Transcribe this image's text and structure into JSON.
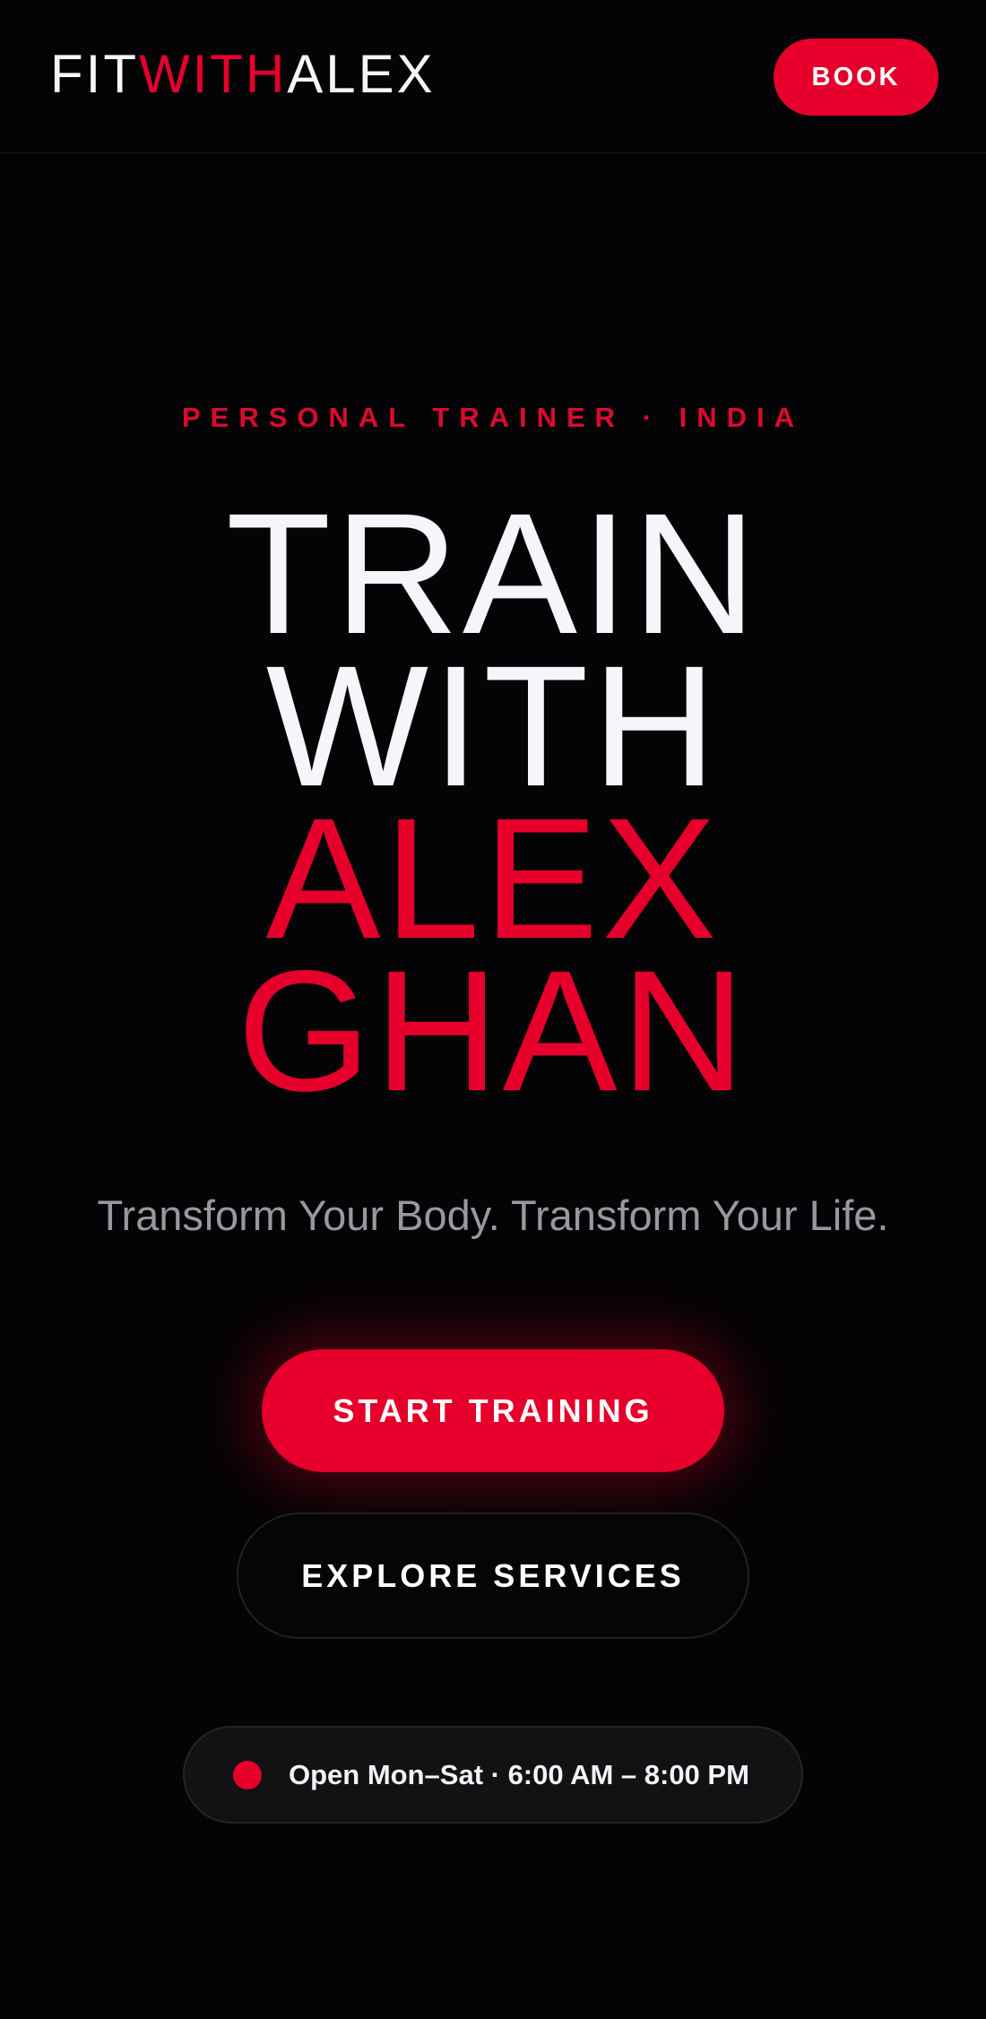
{
  "header": {
    "logo": {
      "part1": "FIT",
      "part2": "WITH",
      "part3": "ALEX"
    },
    "book_label": "BOOK"
  },
  "hero": {
    "eyebrow": "PERSONAL TRAINER · INDIA",
    "title_lines": [
      "TRAIN",
      "WITH",
      "ALEX",
      "GHAN"
    ],
    "tagline": "Transform Your Body. Transform Your Life.",
    "primary_cta": "START TRAINING",
    "secondary_cta": "EXPLORE SERVICES"
  },
  "hours": {
    "text": "Open Mon–Sat · 6:00 AM – 8:00 PM",
    "status_indicator": "red-dot-icon"
  },
  "colors": {
    "accent": "#e6002b",
    "background": "#040305",
    "text_primary": "#f7f5f9",
    "text_muted": "#9a989e"
  }
}
